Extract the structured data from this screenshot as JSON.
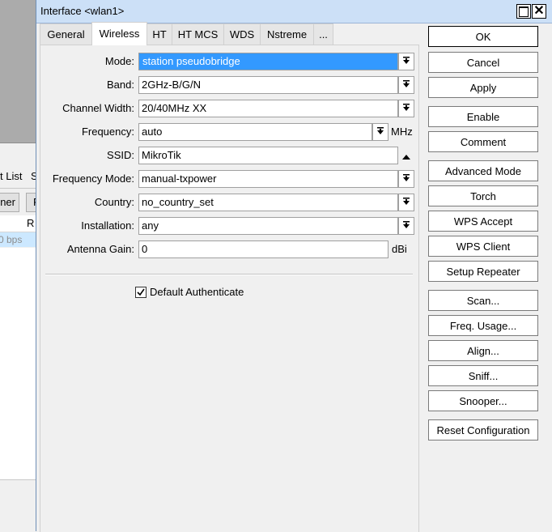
{
  "background": {
    "tabs": [
      "t List",
      "S"
    ],
    "buttons": [
      "ner",
      "F"
    ],
    "header_col": "R",
    "row_value": "0 bps"
  },
  "window": {
    "title": "Interface <wlan1>"
  },
  "tabs": [
    {
      "label": "General"
    },
    {
      "label": "Wireless"
    },
    {
      "label": "HT"
    },
    {
      "label": "HT MCS"
    },
    {
      "label": "WDS"
    },
    {
      "label": "Nstreme"
    },
    {
      "label": "..."
    }
  ],
  "form": {
    "mode": {
      "label": "Mode:",
      "value": "station pseudobridge"
    },
    "band": {
      "label": "Band:",
      "value": "2GHz-B/G/N"
    },
    "channel_width": {
      "label": "Channel Width:",
      "value": "20/40MHz XX"
    },
    "frequency": {
      "label": "Frequency:",
      "value": "auto",
      "unit": "MHz"
    },
    "ssid": {
      "label": "SSID:",
      "value": "MikroTik"
    },
    "frequency_mode": {
      "label": "Frequency Mode:",
      "value": "manual-txpower"
    },
    "country": {
      "label": "Country:",
      "value": "no_country_set"
    },
    "installation": {
      "label": "Installation:",
      "value": "any"
    },
    "antenna_gain": {
      "label": "Antenna Gain:",
      "value": "0",
      "unit": "dBi"
    },
    "default_authenticate": {
      "label": "Default Authenticate",
      "checked": true
    }
  },
  "buttons": {
    "ok": "OK",
    "cancel": "Cancel",
    "apply": "Apply",
    "enable": "Enable",
    "comment": "Comment",
    "advanced_mode": "Advanced Mode",
    "torch": "Torch",
    "wps_accept": "WPS Accept",
    "wps_client": "WPS Client",
    "setup_repeater": "Setup Repeater",
    "scan": "Scan...",
    "freq_usage": "Freq. Usage...",
    "align": "Align...",
    "sniff": "Sniff...",
    "snooper": "Snooper...",
    "reset_configuration": "Reset Configuration"
  },
  "colors": {
    "selection": "#3399ff",
    "titlebar": "#cce0f7"
  }
}
